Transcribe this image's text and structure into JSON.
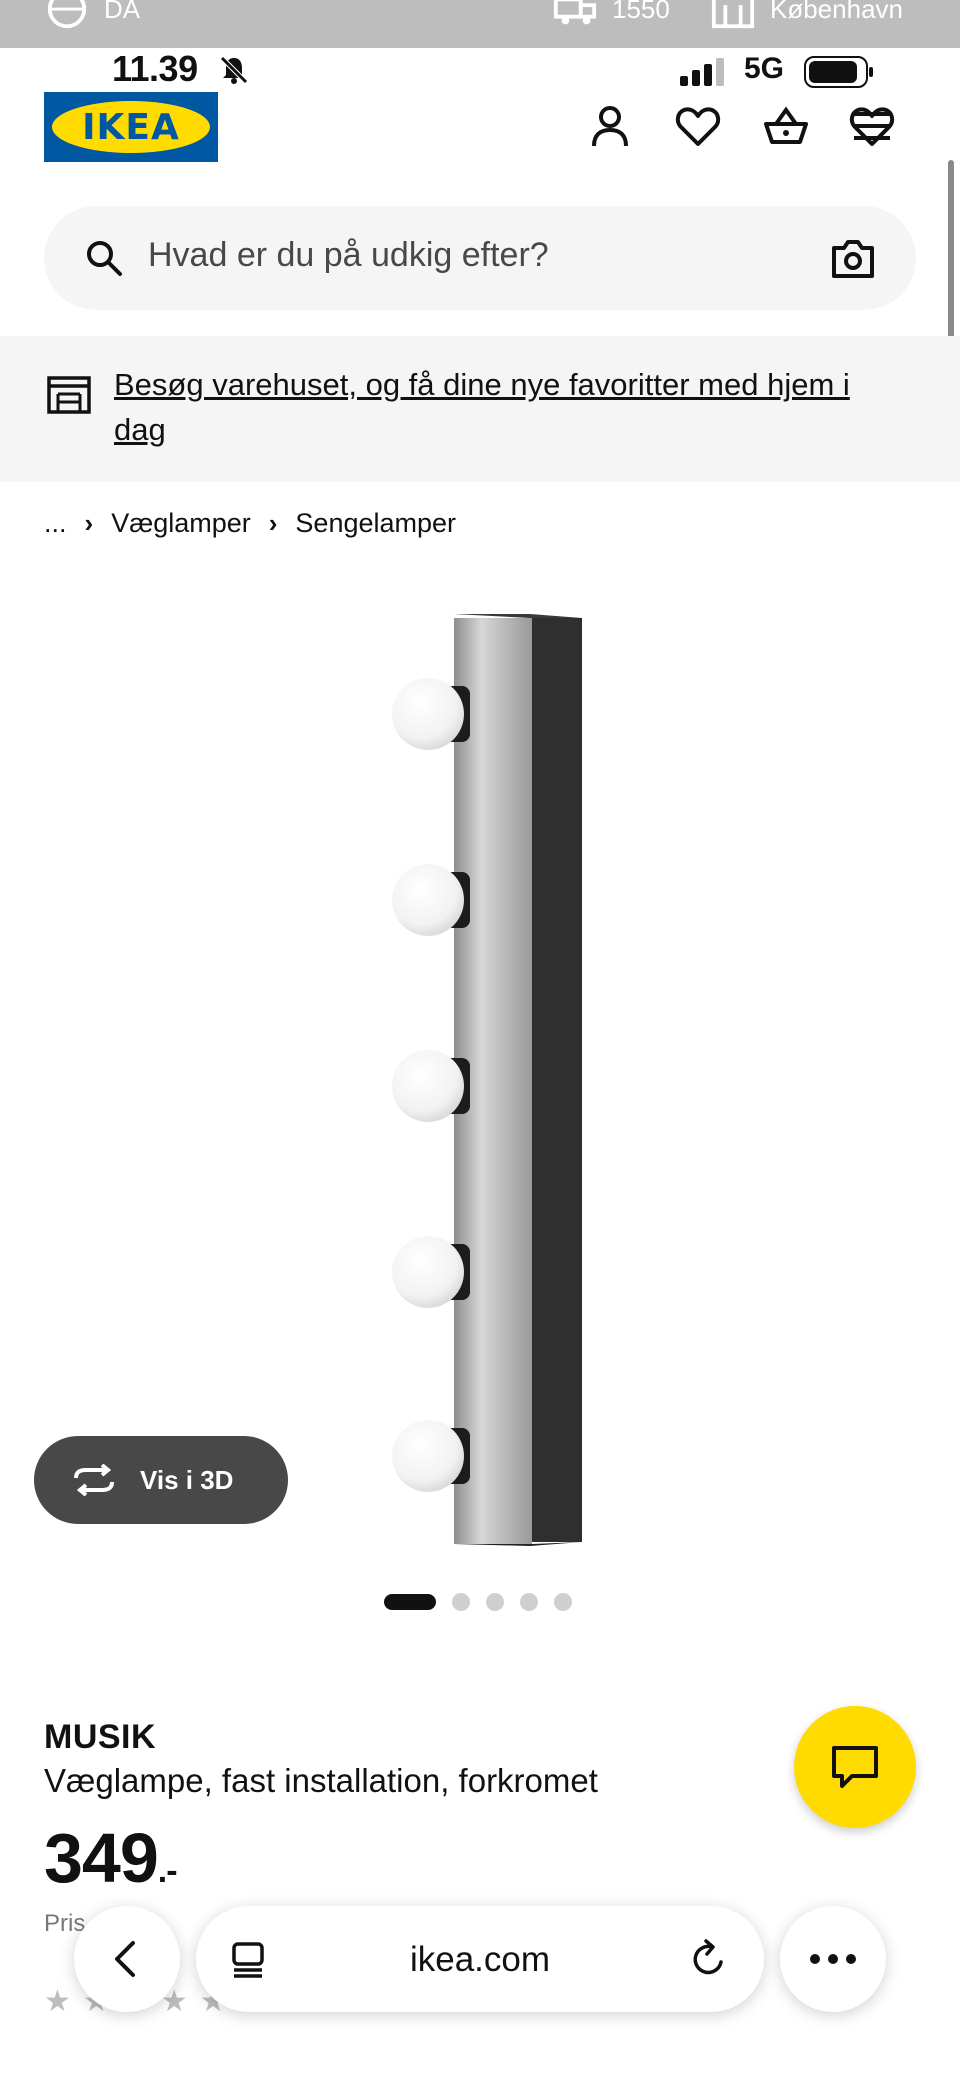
{
  "top_strip": {
    "language": "DA",
    "postal_code": "1550",
    "store": "København"
  },
  "status_bar": {
    "time": "11.39",
    "network": "5G"
  },
  "header": {
    "logo_text": "IKEA",
    "icons": [
      "profile-icon",
      "heart-icon",
      "basket-icon",
      "menu-icon"
    ]
  },
  "search": {
    "placeholder": "Hvad er du på udkig efter?"
  },
  "banner": {
    "text": "Besøg varehuset, og få dine nye favoritter med hjem i dag"
  },
  "breadcrumb": {
    "items": [
      "...",
      "Væglamper",
      "Sengelamper"
    ]
  },
  "gallery": {
    "view_3d_label": "Vis i 3D",
    "dots_total": 5,
    "active_dot": 1
  },
  "product": {
    "name": "MUSIK",
    "description": "Væglampe, fast installation, forkromet",
    "price": "349",
    "price_suffix": ".-",
    "note": "Pris  mom",
    "rating_stars": 5
  },
  "browser": {
    "url": "ikea.com"
  },
  "colors": {
    "ikea_blue": "#0058a3",
    "ikea_yellow": "#ffdb00",
    "dark_button": "#484848",
    "light_gray": "#f5f5f5"
  }
}
